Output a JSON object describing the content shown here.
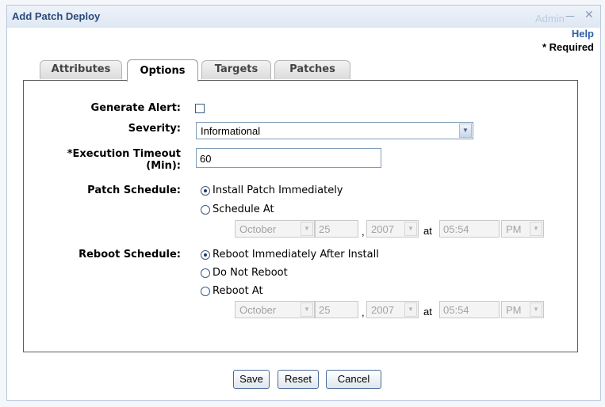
{
  "background": {
    "admin_text": "Admin"
  },
  "dialog": {
    "title": "Add Patch Deploy",
    "minimize_glyph": "—",
    "close_glyph": "✕"
  },
  "help_label": "Help",
  "required_note": "* Required",
  "tabs": [
    {
      "label": "Attributes",
      "active": false
    },
    {
      "label": "Options",
      "active": true
    },
    {
      "label": "Targets",
      "active": false
    },
    {
      "label": "Patches",
      "active": false
    }
  ],
  "form": {
    "generate_alert": {
      "label": "Generate Alert:",
      "checked": false
    },
    "severity": {
      "label": "Severity:",
      "value": "Informational"
    },
    "execution_timeout": {
      "label_line1": "*Execution Timeout",
      "label_line2": "(Min):",
      "value": "60"
    },
    "patch_schedule": {
      "label": "Patch Schedule:",
      "options": [
        {
          "label": "Install Patch Immediately",
          "selected": true
        },
        {
          "label": "Schedule At",
          "selected": false
        }
      ],
      "month": "October",
      "day": "25",
      "year": "2007",
      "at": "at",
      "time": "05:54",
      "ampm": "PM",
      "comma": ","
    },
    "reboot_schedule": {
      "label": "Reboot Schedule:",
      "options": [
        {
          "label": "Reboot Immediately After Install",
          "selected": true
        },
        {
          "label": "Do Not Reboot",
          "selected": false
        },
        {
          "label": "Reboot At",
          "selected": false
        }
      ],
      "month": "October",
      "day": "25",
      "year": "2007",
      "at": "at",
      "time": "05:54",
      "ampm": "PM",
      "comma": ","
    }
  },
  "buttons": {
    "save": "Save",
    "reset": "Reset",
    "cancel": "Cancel"
  },
  "icons": {
    "dropdown": "chevron-down-icon",
    "checkbox": "checkbox-icon",
    "radio": "radio-icon"
  }
}
